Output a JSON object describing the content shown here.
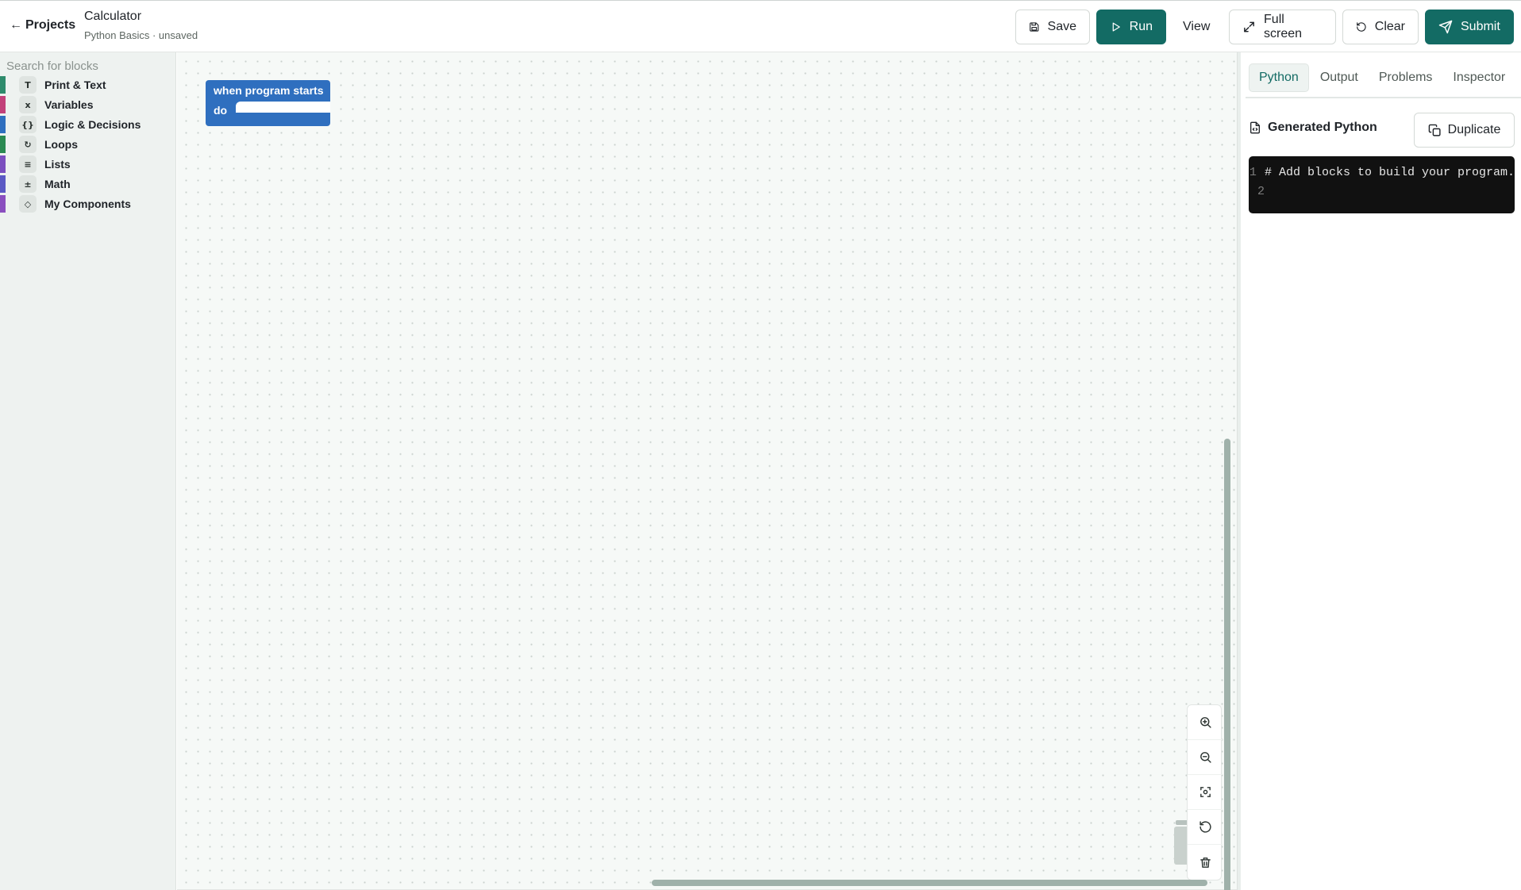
{
  "header": {
    "back_label": "Projects",
    "title": "Calculator",
    "subtitle": "Python Basics · unsaved",
    "buttons": {
      "save": "Save",
      "run": "Run",
      "view": "View",
      "fullscreen": "Full screen",
      "clear": "Clear",
      "submit": "Submit"
    }
  },
  "sidebar": {
    "search_placeholder": "Search for blocks",
    "categories": [
      {
        "label": "Print & Text",
        "glyph": "T",
        "color": "#2e8b6c"
      },
      {
        "label": "Variables",
        "glyph": "x",
        "color": "#c2417a"
      },
      {
        "label": "Logic & Decisions",
        "glyph": "{}",
        "color": "#2f6fbf"
      },
      {
        "label": "Loops",
        "glyph": "↻",
        "color": "#2a8a52"
      },
      {
        "label": "Lists",
        "glyph": "≡",
        "color": "#7b4fbf"
      },
      {
        "label": "Math",
        "glyph": "±",
        "color": "#5b59c4"
      },
      {
        "label": "My Components",
        "glyph": "◇",
        "color": "#8a4fbf"
      }
    ]
  },
  "workspace": {
    "block": {
      "hat_label": "when program starts",
      "do_label": "do",
      "color": "#2f6fbf"
    },
    "zoom_controls": [
      "zoom-in-icon",
      "zoom-out-icon",
      "recenter-icon",
      "reset-icon",
      "trash-icon"
    ]
  },
  "right_panel": {
    "tabs": [
      {
        "label": "Python",
        "active": true
      },
      {
        "label": "Output",
        "active": false
      },
      {
        "label": "Problems",
        "active": false
      },
      {
        "label": "Inspector",
        "active": false
      }
    ],
    "section_title": "Generated Python",
    "duplicate_label": "Duplicate",
    "code_lines": [
      {
        "num": "1",
        "text": "# Add blocks to build your program."
      },
      {
        "num": "2",
        "text": ""
      }
    ]
  },
  "colors": {
    "primary": "#136b64",
    "block_blue": "#2f6fbf",
    "code_bg": "#111111"
  }
}
